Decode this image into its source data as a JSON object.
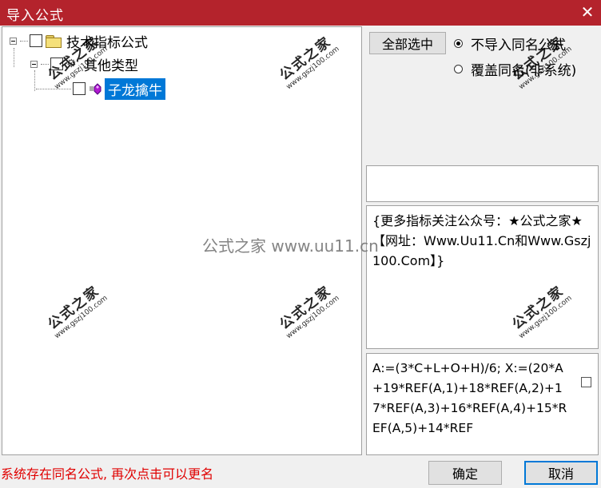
{
  "window": {
    "title": "导入公式",
    "close_glyph": "✕"
  },
  "tree": {
    "root": {
      "label": "技术指标公式",
      "icon": "folder-icon"
    },
    "group": {
      "label": "其他类型",
      "icon": "gear-icon"
    },
    "item": {
      "label": "子龙擒牛",
      "icon": "formula-icon",
      "selected": true
    }
  },
  "buttons": {
    "select_all": "全部选中",
    "ok": "确定",
    "cancel": "取消"
  },
  "options": {
    "no_import": "不导入同名公式",
    "overwrite": "覆盖同名(非系统)",
    "selected": "no_import"
  },
  "description": "{更多指标关注公众号：★公式之家★ 【网址：Www.Uu11.Cn和Www.Gszj100.Com】}",
  "formula_code": "A:=(3*C+L+O+H)/6; X:=(20*A+19*REF(A,1)+18*REF(A,2)+17*REF(A,3)+16*REF(A,4)+15*REF(A,5)+14*REF",
  "status_message": "系统存在同名公式, 再次点击可以更名",
  "watermark": {
    "brand": "公式之家",
    "site": "www.gszj100.com",
    "center": "公式之家 www.uu11.cn"
  },
  "colors": {
    "titlebar": "#b4232c",
    "selection": "#0078d7",
    "status": "#e00000"
  }
}
